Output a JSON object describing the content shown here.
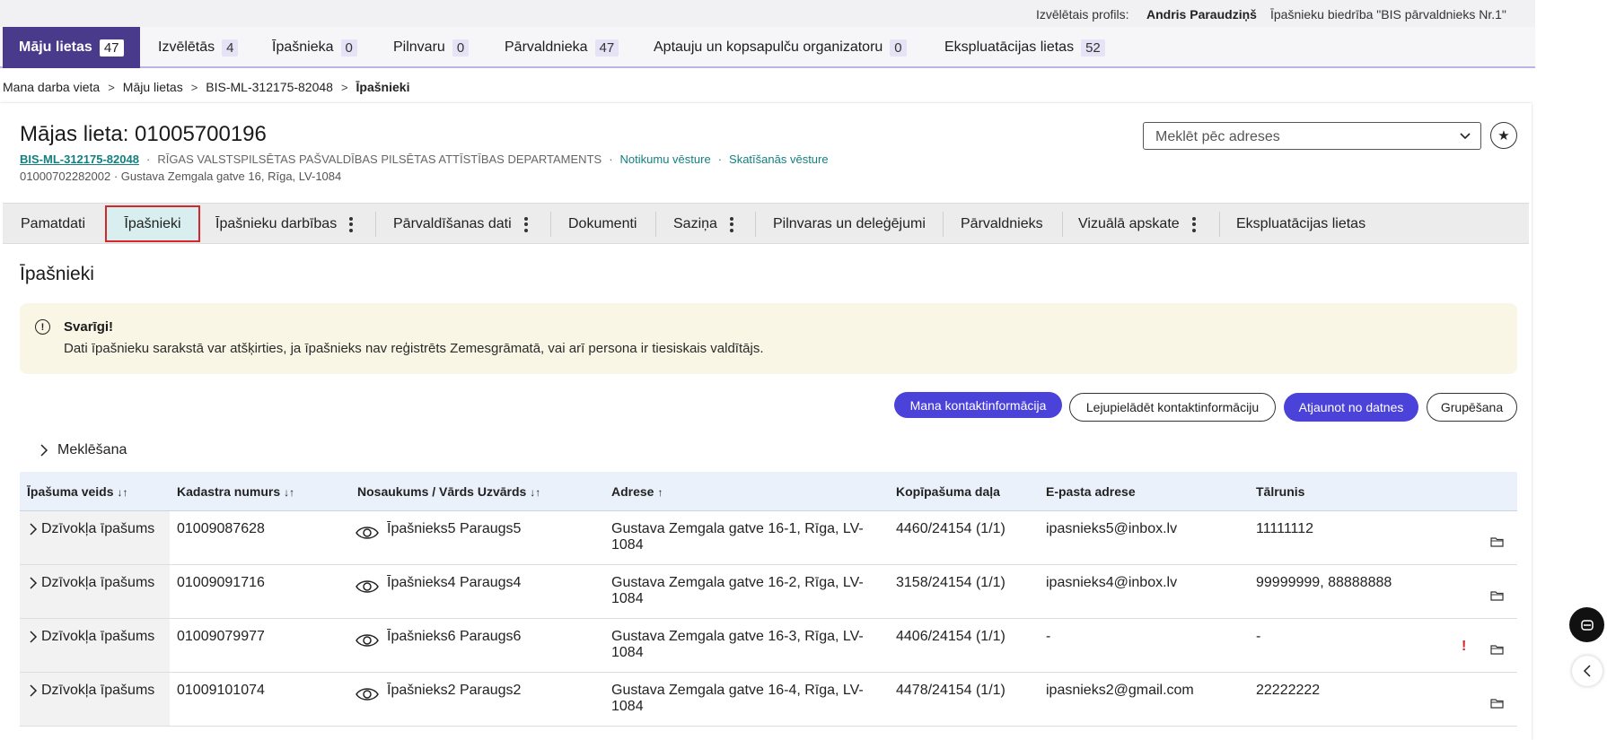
{
  "profile": {
    "label": "Izvēlētais profils:",
    "name": "Andris Paraudziņš",
    "org": "Īpašnieku biedrība \"BIS pārvaldnieks Nr.1\""
  },
  "main_tabs": [
    {
      "label": "Māju lietas",
      "count": "47"
    },
    {
      "label": "Izvēlētās",
      "count": "4"
    },
    {
      "label": "Īpašnieka",
      "count": "0"
    },
    {
      "label": "Pilnvaru",
      "count": "0"
    },
    {
      "label": "Pārvaldnieka",
      "count": "47"
    },
    {
      "label": "Aptauju un kopsapulču organizatoru",
      "count": "0"
    },
    {
      "label": "Ekspluatācijas lietas",
      "count": "52"
    }
  ],
  "breadcrumb": [
    "Mana darba vieta",
    "Māju lietas",
    "BIS-ML-312175-82048",
    "Īpašnieki"
  ],
  "case": {
    "title": "Mājas lieta: 01005700196",
    "case_id": "BIS-ML-312175-82048",
    "department": "RĪGAS VALSTSPILSĒTAS PAŠVALDĪBAS PILSĒTAS ATTĪSTĪBAS DEPARTAMENTS",
    "events_link": "Notikumu vēsture",
    "views_link": "Skatīšanās vēsture",
    "dot": "·",
    "location": "01000702282002 · Gustava Zemgala gatve 16, Rīga, LV-1084"
  },
  "address_search": {
    "placeholder": "Meklēt pēc adreses"
  },
  "section_tabs": [
    {
      "label": "Pamatdati"
    },
    {
      "label": "Īpašnieki"
    },
    {
      "label": "Īpašnieku darbības"
    },
    {
      "label": "Pārvaldīšanas dati"
    },
    {
      "label": "Dokumenti"
    },
    {
      "label": "Saziņa"
    },
    {
      "label": "Pilnvaras un deleģējumi"
    },
    {
      "label": "Pārvaldnieks"
    },
    {
      "label": "Vizuālā apskate"
    },
    {
      "label": "Ekspluatācijas lietas"
    }
  ],
  "section_title": "Īpašnieki",
  "alert": {
    "title": "Svarīgi!",
    "text": "Dati īpašnieku sarakstā var atšķirties, ja īpašnieks nav reģistrēts Zemesgrāmatā, vai arī persona ir tiesiskais valdītājs."
  },
  "actions": {
    "my_contact": "Mana kontaktinformācija",
    "download_contact": "Lejupielādēt kontaktinformāciju",
    "update_from_file": "Atjaunot no datnes",
    "grouping": "Grupēšana"
  },
  "search_toggle": "Meklēšana",
  "table": {
    "headers": {
      "type": "Īpašuma veids",
      "cadastre": "Kadastra numurs",
      "name": "Nosaukums / Vārds Uzvārds",
      "address": "Adrese",
      "share": "Kopīpašuma daļa",
      "email": "E-pasta adrese",
      "phone": "Tālrunis"
    },
    "sort_both": "↓↑",
    "sort_up": "↑",
    "rows": [
      {
        "type": "Dzīvokļa īpašums",
        "cadastre": "01009087628",
        "name": "Īpašnieks5 Paraugs5",
        "address": "Gustava Zemgala gatve 16-1, Rīga, LV-1084",
        "share": "4460/24154 (1/1)",
        "email": "ipasnieks5@inbox.lv",
        "phone": "11111112"
      },
      {
        "type": "Dzīvokļa īpašums",
        "cadastre": "01009091716",
        "name": "Īpašnieks4 Paraugs4",
        "address": "Gustava Zemgala gatve 16-2, Rīga, LV-1084",
        "share": "3158/24154 (1/1)",
        "email": "ipasnieks4@inbox.lv",
        "phone": "99999999, 88888888"
      },
      {
        "type": "Dzīvokļa īpašums",
        "cadastre": "01009079977",
        "name": "Īpašnieks6 Paraugs6",
        "address": "Gustava Zemgala gatve 16-3, Rīga, LV-1084",
        "share": "4406/24154 (1/1)",
        "email": "-",
        "phone": "-",
        "warning": "!"
      },
      {
        "type": "Dzīvokļa īpašums",
        "cadastre": "01009101074",
        "name": "Īpašnieks2 Paraugs2",
        "address": "Gustava Zemgala gatve 16-4, Rīga, LV-1084",
        "share": "4478/24154 (1/1)",
        "email": "ipasnieks2@gmail.com",
        "phone": "22222222"
      }
    ]
  },
  "icons": {
    "star": "★",
    "alert": "!",
    "chevron_right": "chevron-right-icon",
    "eye": "eye-icon",
    "folder": "folder-icon"
  },
  "colors": {
    "active_tab": "#4a3a8c",
    "primary_button": "#4b42d9",
    "link_teal": "#137f7f",
    "alert_bg": "#faf6e6",
    "active_section_border": "#d4262b"
  }
}
